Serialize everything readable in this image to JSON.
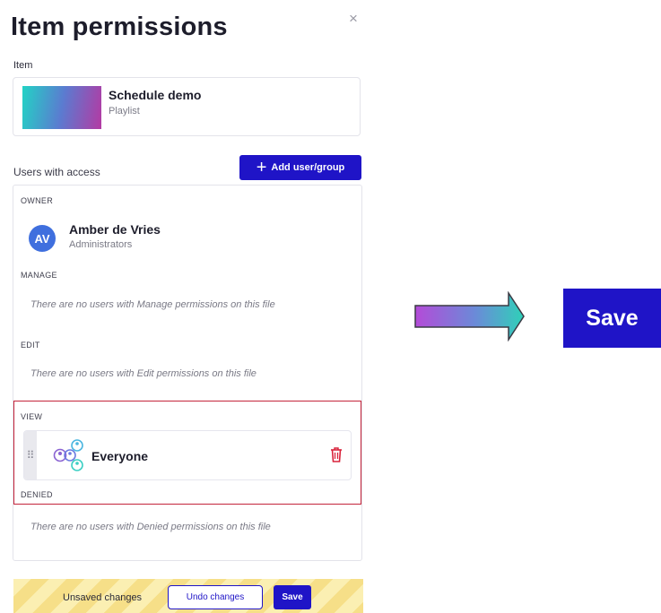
{
  "dialog": {
    "title": "Item permissions",
    "close_icon": "×"
  },
  "item": {
    "label": "Item",
    "name": "Schedule demo",
    "type": "Playlist"
  },
  "users": {
    "label": "Users with access",
    "add_button_icon": "+",
    "add_button_label": "Add user/group"
  },
  "sections": {
    "owner": {
      "label": "OWNER",
      "avatar_initials": "AV",
      "name": "Amber de Vries",
      "role": "Administrators"
    },
    "manage": {
      "label": "MANAGE",
      "empty": "There are no users with Manage permissions on this file"
    },
    "edit": {
      "label": "EDIT",
      "empty": "There are no users with Edit permissions on this file"
    },
    "view": {
      "label": "VIEW",
      "drag_icon": "⠿",
      "group_name": "Everyone"
    },
    "denied": {
      "label": "DENIED",
      "empty": "There are no users with Denied permissions on this file"
    }
  },
  "footer": {
    "unsaved_text": "Unsaved changes",
    "undo_label": "Undo changes",
    "save_label": "Save"
  },
  "annotation": {
    "save_label": "Save"
  },
  "colors": {
    "primary": "#1f14c7",
    "highlight_border": "#c4253b",
    "trash": "#d9243c",
    "avatar": "#3f6fde"
  }
}
